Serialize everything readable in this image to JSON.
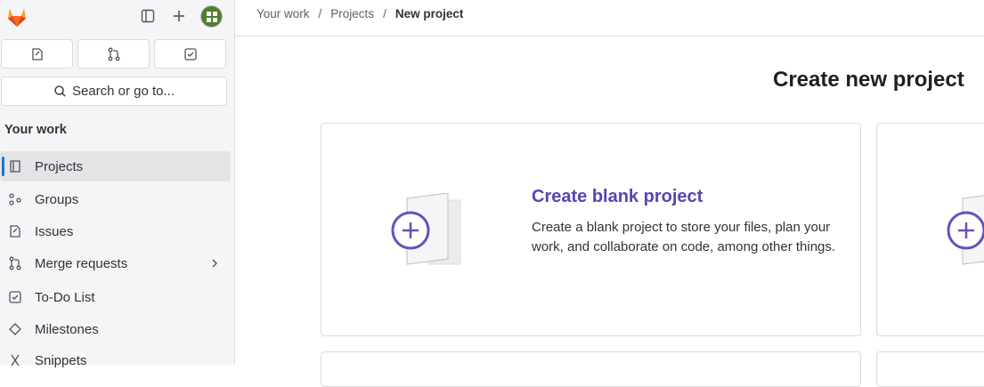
{
  "header": {
    "avatar_alt": "user avatar"
  },
  "quick_actions": [
    "issues",
    "merge-requests",
    "todos"
  ],
  "search": {
    "label": "Search or go to..."
  },
  "sidebar": {
    "section_title": "Your work",
    "items": [
      {
        "label": "Projects",
        "icon": "project-icon",
        "active": true
      },
      {
        "label": "Groups",
        "icon": "group-icon"
      },
      {
        "label": "Issues",
        "icon": "issues-icon"
      },
      {
        "label": "Merge requests",
        "icon": "merge-request-icon",
        "has_chevron": true
      },
      {
        "label": "To-Do List",
        "icon": "todo-icon"
      },
      {
        "label": "Milestones",
        "icon": "milestone-icon"
      },
      {
        "label": "Snippets",
        "icon": "snippet-icon"
      }
    ]
  },
  "breadcrumb": {
    "items": [
      "Your work",
      "Projects",
      "New project"
    ],
    "separator": "/"
  },
  "page": {
    "title": "Create new project"
  },
  "cards": [
    {
      "title": "Create blank project",
      "description": "Create a blank project to store your files, plan your work, and collaborate on code, among other things."
    }
  ],
  "colors": {
    "accent": "#5943b6",
    "active_bar": "#1f75cb",
    "sidebar_bg": "#f5f5f7"
  }
}
